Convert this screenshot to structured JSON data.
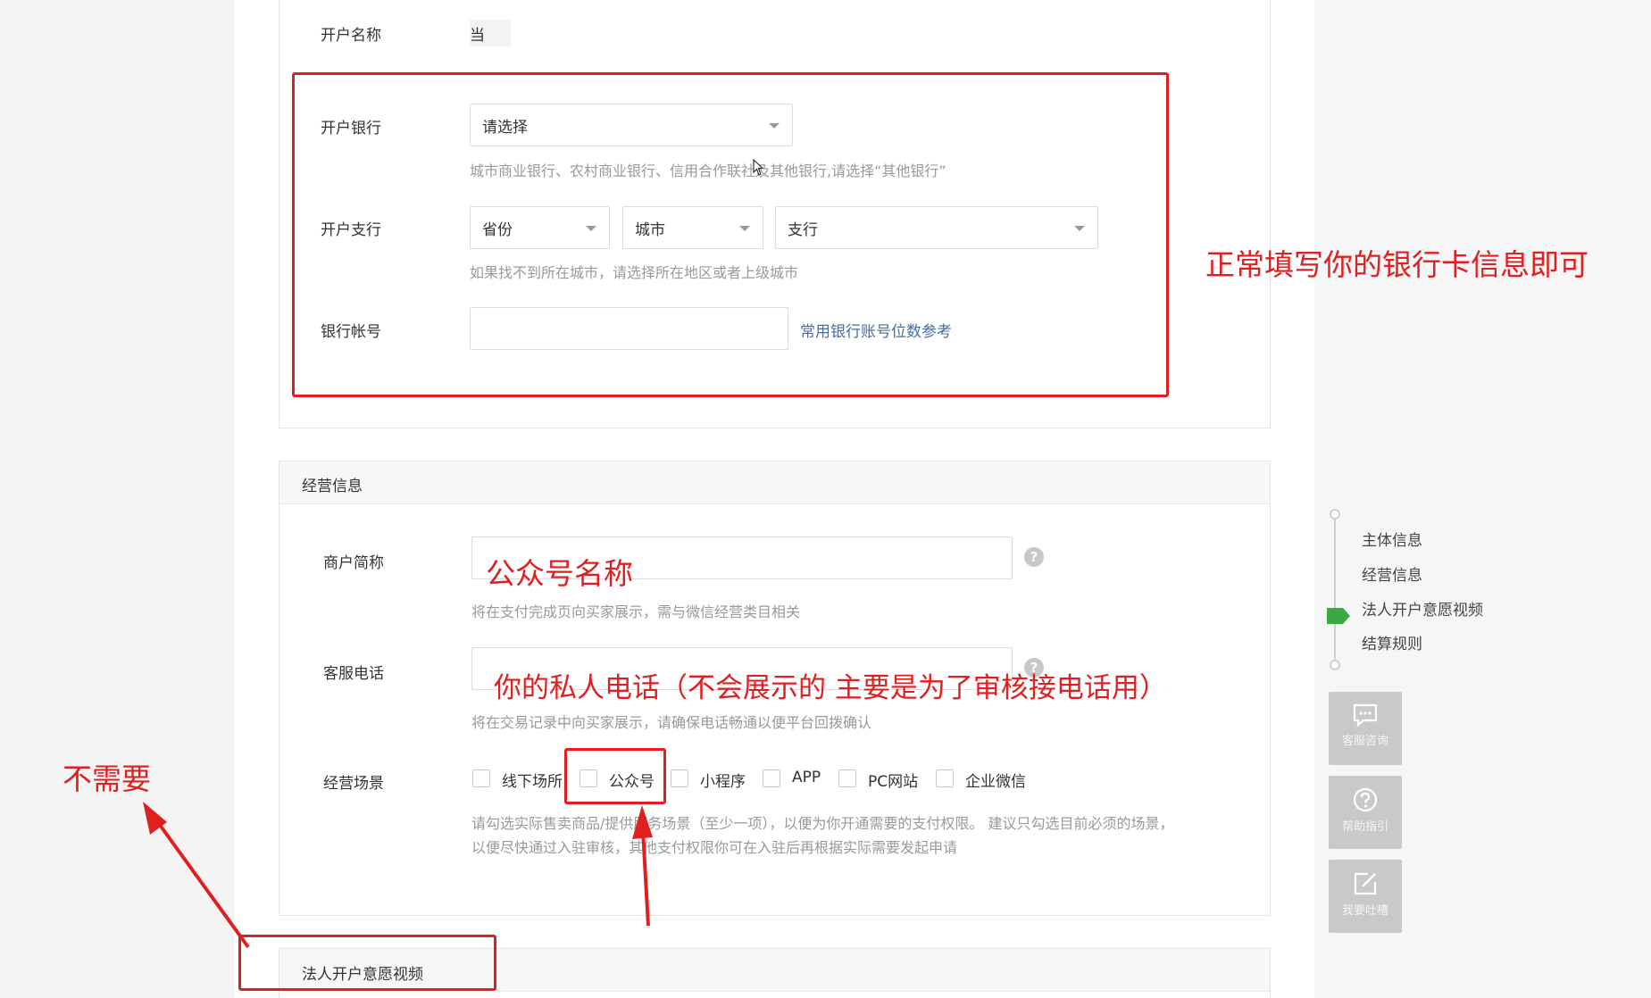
{
  "account": {
    "name_label": "开户名称",
    "name_value": "当"
  },
  "bank": {
    "bank_label": "开户银行",
    "bank_select": "请选择",
    "bank_hint": "城市商业银行、农村商业银行、信用合作联社及其他银行,请选择“其他银行”",
    "branch_label": "开户支行",
    "province_select": "省份",
    "city_select": "城市",
    "branch_select": "支行",
    "branch_hint": "如果找不到所在城市，请选择所在地区或者上级城市",
    "account_label": "银行帐号",
    "account_value": "",
    "account_ref_link": "常用银行账号位数参考"
  },
  "business": {
    "section_title": "经营信息",
    "short_name_label": "商户简称",
    "short_name_value": "",
    "short_name_hint": "将在支付完成页向买家展示，需与微信经营类目相关",
    "phone_label": "客服电话",
    "phone_value": "",
    "phone_hint": "将在交易记录中向买家展示，请确保电话畅通以便平台回拨确认",
    "scene_label": "经营场景",
    "scenes": [
      "线下场所",
      "公众号",
      "小程序",
      "APP",
      "PC网站",
      "企业微信"
    ],
    "scene_hint_1": "请勾选实际售卖商品/提供服务场景（至少一项），以便为你开通需要的支付权限。 建议只勾选目前必须的场景，",
    "scene_hint_2": "以便尽快通过入驻审核，其他支付权限你可在入驻后再根据实际需要发起申请"
  },
  "legal_video": {
    "section_title": "法人开户意愿视频"
  },
  "progress": {
    "steps": [
      "主体信息",
      "经营信息",
      "法人开户意愿视频",
      "结算规则"
    ],
    "active_index": 2,
    "active_color": "#3aa843"
  },
  "side_buttons": {
    "service": "客服咨询",
    "help": "帮助指引",
    "feedback": "我要吐槽"
  },
  "annotations": {
    "bank_note": "正常填写你的银行卡信息即可",
    "short_name_note": "公众号名称",
    "phone_note": "你的私人电话（不会展示的 主要是为了审核接电话用）",
    "not_needed_note": "不需要",
    "color": "#e02020"
  }
}
